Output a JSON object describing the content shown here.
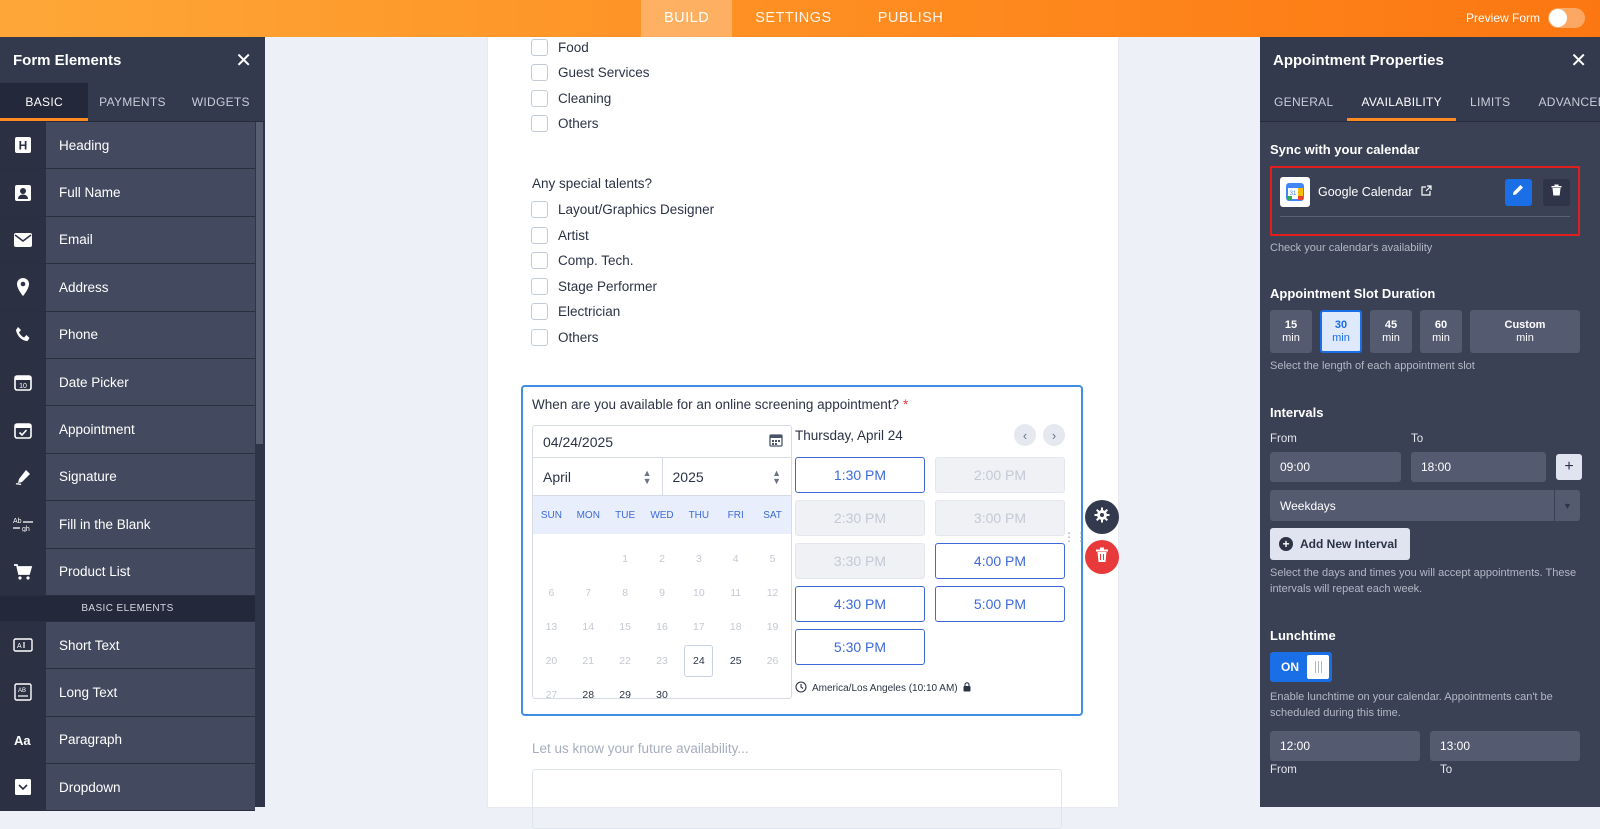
{
  "topbar": {
    "tabs": [
      "BUILD",
      "SETTINGS",
      "PUBLISH"
    ],
    "preview_label": "Preview Form"
  },
  "left_panel": {
    "title": "Form Elements",
    "tabs": [
      "BASIC",
      "PAYMENTS",
      "WIDGETS"
    ],
    "items": [
      {
        "label": "Heading",
        "icon": "heading-icon"
      },
      {
        "label": "Full Name",
        "icon": "person-icon"
      },
      {
        "label": "Email",
        "icon": "envelope-icon"
      },
      {
        "label": "Address",
        "icon": "location-pin-icon"
      },
      {
        "label": "Phone",
        "icon": "phone-icon"
      },
      {
        "label": "Date Picker",
        "icon": "calendar-icon"
      },
      {
        "label": "Appointment",
        "icon": "calendar-check-icon"
      },
      {
        "label": "Signature",
        "icon": "signature-pen-icon"
      },
      {
        "label": "Fill in the Blank",
        "icon": "fill-blank-icon"
      },
      {
        "label": "Product List",
        "icon": "cart-icon"
      }
    ],
    "section_label": "BASIC ELEMENTS",
    "items2": [
      {
        "label": "Short Text",
        "icon": "short-text-icon"
      },
      {
        "label": "Long Text",
        "icon": "long-text-icon"
      },
      {
        "label": "Paragraph",
        "icon": "paragraph-icon"
      },
      {
        "label": "Dropdown",
        "icon": "dropdown-icon"
      }
    ]
  },
  "form": {
    "q1_options": [
      "Food",
      "Guest Services",
      "Cleaning",
      "Others"
    ],
    "q2_label": "Any special talents?",
    "q2_options": [
      "Layout/Graphics Designer",
      "Artist",
      "Comp. Tech.",
      "Stage Performer",
      "Electrician",
      "Others"
    ],
    "appointment": {
      "question": "When are you available for an online screening appointment?",
      "required_mark": "*",
      "date_value": "04/24/2025",
      "month": "April",
      "year": "2025",
      "weekdays": [
        "SUN",
        "MON",
        "TUE",
        "WED",
        "THU",
        "FRI",
        "SAT"
      ],
      "days": [
        "",
        "",
        "1",
        "2",
        "3",
        "4",
        "5",
        "6",
        "7",
        "8",
        "9",
        "10",
        "11",
        "12",
        "13",
        "14",
        "15",
        "16",
        "17",
        "18",
        "19",
        "20",
        "21",
        "22",
        "23",
        "24",
        "25",
        "26",
        "27",
        "28",
        "29",
        "30"
      ],
      "selected_day": "24",
      "available_days": [
        "25",
        "28",
        "29",
        "30"
      ],
      "selected_date_label": "Thursday, April 24",
      "slots": [
        {
          "time": "1:30 PM",
          "available": true
        },
        {
          "time": "2:00 PM",
          "available": false
        },
        {
          "time": "2:30 PM",
          "available": false
        },
        {
          "time": "3:00 PM",
          "available": false
        },
        {
          "time": "3:30 PM",
          "available": false
        },
        {
          "time": "4:00 PM",
          "available": true
        },
        {
          "time": "4:30 PM",
          "available": true
        },
        {
          "time": "5:00 PM",
          "available": true
        },
        {
          "time": "5:30 PM",
          "available": true
        }
      ],
      "timezone": "America/Los Angeles (10:10 AM)"
    },
    "future_label": "Let us know your future availability..."
  },
  "right_panel": {
    "title": "Appointment Properties",
    "tabs": [
      "GENERAL",
      "AVAILABILITY",
      "LIMITS",
      "ADVANCED"
    ],
    "active_tab": "AVAILABILITY",
    "sync_title": "Sync with your calendar",
    "calendar_name": "Google Calendar",
    "sync_help": "Check your calendar's availability",
    "duration_title": "Appointment Slot Duration",
    "durations": [
      {
        "n": "15",
        "u": "min"
      },
      {
        "n": "30",
        "u": "min"
      },
      {
        "n": "45",
        "u": "min"
      },
      {
        "n": "60",
        "u": "min"
      },
      {
        "n": "Custom",
        "u": "min"
      }
    ],
    "selected_duration": "30",
    "duration_help": "Select the length of each appointment slot",
    "intervals_title": "Intervals",
    "from_label": "From",
    "to_label": "To",
    "from_value": "09:00",
    "to_value": "18:00",
    "days_value": "Weekdays",
    "add_interval_label": "Add New Interval",
    "intervals_help": "Select the days and times you will accept appointments. These intervals will repeat each week.",
    "lunch_title": "Lunchtime",
    "lunch_toggle": "ON",
    "lunch_help": "Enable lunchtime on your calendar. Appointments can't be scheduled during this time.",
    "lunch_from": "12:00",
    "lunch_to": "13:00",
    "lunch_from_label": "From",
    "lunch_to_label": "To"
  },
  "colors": {
    "accent_orange": "#fe8a1e",
    "blue": "#1a6ee6",
    "panel_dark": "#2f3448",
    "danger": "#e83a3a"
  }
}
